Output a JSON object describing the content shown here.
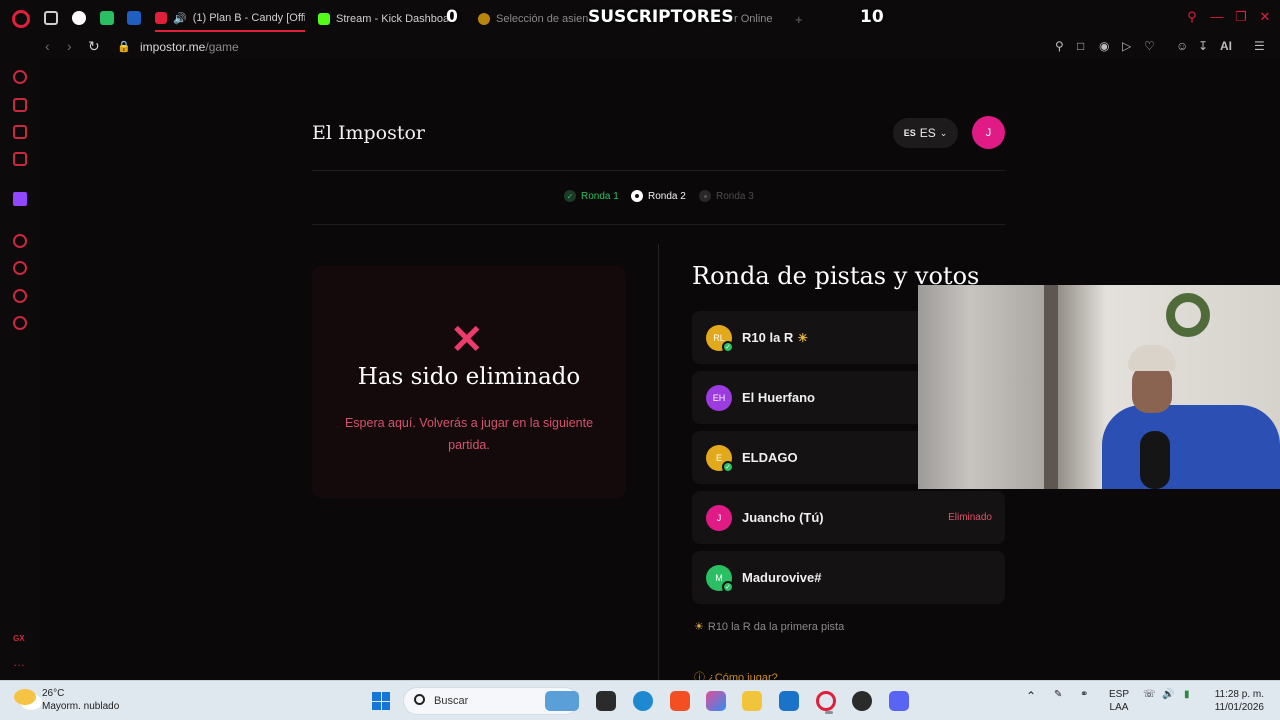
{
  "browser": {
    "tabs": [
      {
        "label": "(1) Plan B - Candy [Offi",
        "color": "#e0203a"
      },
      {
        "label": "Stream - Kick Dashboard",
        "color": "#53fc18"
      },
      {
        "label": "Selección de asient",
        "color": "#b8860b"
      },
      {
        "label": "r Online",
        "color": "#e0203a"
      }
    ],
    "overlay": {
      "left_count": "0",
      "label": "SUSCRIPTORES",
      "right_count": "10"
    },
    "new_tab": "+",
    "url_host": "impostor.me",
    "url_path": "/game",
    "toolbar_ai": "AI"
  },
  "page": {
    "site_title": "El Impostor",
    "lang_small": "ES",
    "lang_label": "ES",
    "user_initial": "J",
    "rounds": [
      {
        "label": "Ronda 1",
        "state": "done"
      },
      {
        "label": "Ronda 2",
        "state": "current"
      },
      {
        "label": "Ronda 3",
        "state": "pending"
      }
    ],
    "eliminated": {
      "title": "Has sido eliminado",
      "subtitle": "Espera aquí. Volverás a jugar en la siguiente partida."
    },
    "section_title": "Ronda de pistas y votos",
    "players": [
      {
        "initials": "RL",
        "name": "R10 la R",
        "color": "#e3a91c",
        "checked": true,
        "starter": true,
        "status": ""
      },
      {
        "initials": "EH",
        "name": "El Huerfano",
        "color": "#9c3be0",
        "checked": false,
        "starter": false,
        "status": ""
      },
      {
        "initials": "E",
        "name": "ELDAGO",
        "color": "#e3a91c",
        "checked": true,
        "starter": false,
        "status": ""
      },
      {
        "initials": "J",
        "name": "Juancho (Tú)",
        "color": "#e01b86",
        "checked": false,
        "starter": false,
        "status": "Eliminado"
      },
      {
        "initials": "M",
        "name": "Madurovive#",
        "color": "#2bbf63",
        "checked": true,
        "starter": false,
        "status": ""
      }
    ],
    "hint": "R10 la R da la primera pista",
    "how_to_play": "¿Cómo jugar?"
  },
  "taskbar": {
    "temp": "26°C",
    "weather": "Mayorm. nublado",
    "search_label": "Buscar",
    "lang_top": "ESP",
    "lang_bottom": "LAA",
    "time": "11:28 p. m.",
    "date": "11/01/2026"
  },
  "colors": {
    "accent": "#e0203a",
    "success": "#2bbf63",
    "danger": "#ef3a6c",
    "bg": "#0a0809"
  }
}
